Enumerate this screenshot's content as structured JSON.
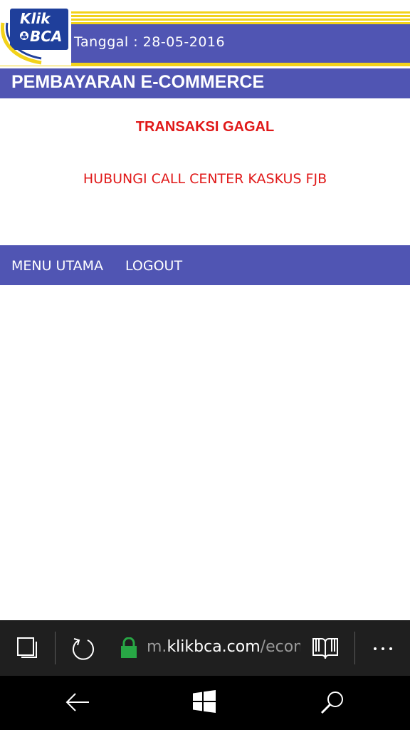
{
  "header": {
    "logo_line1": "Klik",
    "logo_line2": "BCA",
    "date_label": "Tanggal : 28-05-2016"
  },
  "page": {
    "title": "PEMBAYARAN E-COMMERCE",
    "status_title": "TRANSAKSI GAGAL",
    "status_message": "HUBUNGI CALL CENTER KASKUS FJB"
  },
  "menu": {
    "items": [
      {
        "label": "MENU UTAMA"
      },
      {
        "label": "LOGOUT"
      }
    ]
  },
  "browser": {
    "url_prefix": "m.",
    "url_domain": "klikbca.com",
    "url_path": "/ecom",
    "icons": [
      "tabs-icon",
      "refresh-icon",
      "lock-icon",
      "reading-view-icon",
      "more-icon"
    ]
  },
  "system_nav": {
    "icons": [
      "back-icon",
      "windows-start-icon",
      "search-icon"
    ]
  },
  "colors": {
    "brand_blue": "#5055b3",
    "stripe_yellow": "#f2d21a",
    "error_red": "#e01818",
    "logo_blue": "#1f3f9b"
  }
}
